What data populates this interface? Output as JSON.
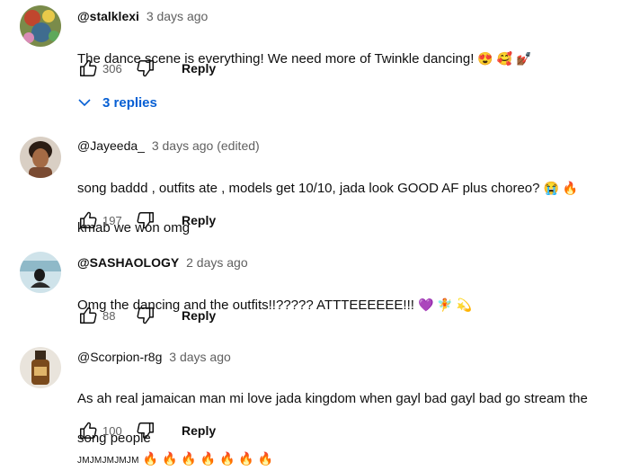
{
  "comments": [
    {
      "author": "@stalklexi",
      "time": "3 days ago",
      "text": "The dance scene is everything! We need more of Twinkle dancing!",
      "emojis": "😍 🥰 💅🏾",
      "likes": "306",
      "reply_label": "Reply",
      "replies_label": "3 replies"
    },
    {
      "author": "@Jayeeda_",
      "time": "3 days ago (edited)",
      "text": "song baddd , outfits ate , models get 10/10, jada look GOOD AF plus choreo?",
      "emojis": "😭 🔥",
      "text2": "kmab we won omg",
      "likes": "197",
      "reply_label": "Reply"
    },
    {
      "author": "@SASHAOLOGY",
      "time": "2 days ago",
      "text": "Omg the dancing and the outfits!!?????  ATTTEEEEEE!!!",
      "emojis": "💜 🧚 💫",
      "likes": "88",
      "reply_label": "Reply"
    },
    {
      "author": "@Scorpion-r8g",
      "time": "3 days ago",
      "text": "As ah real jamaican man mi love jada kingdom when gayl bad gayl bad go stream the",
      "text2": "song people",
      "small_text": "JMJMJMJMJM",
      "emojis": "🔥 🔥 🔥 🔥 🔥 🔥 🔥",
      "likes": "100",
      "reply_label": "Reply"
    }
  ],
  "icons": {
    "like": "thumb-up-icon",
    "dislike": "thumb-down-icon",
    "chevron": "chevron-down-icon"
  },
  "colors": {
    "link_blue": "#065fd4",
    "secondary_text": "#606060"
  }
}
